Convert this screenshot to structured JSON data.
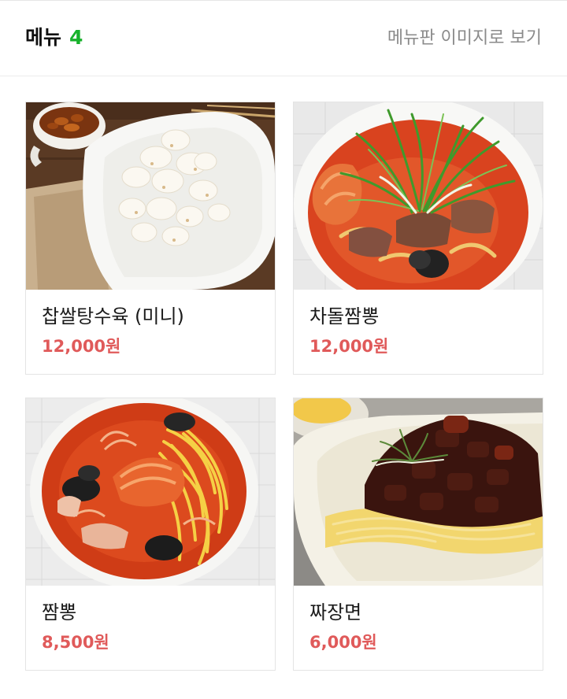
{
  "header": {
    "title": "메뉴",
    "count": "4",
    "board_link": "메뉴판 이미지로 보기"
  },
  "menu_items": [
    {
      "name": "찹쌀탕수육 (미니)",
      "price": "12,000원",
      "image": "sweet-sour-pork-photo"
    },
    {
      "name": "차돌짬뽕",
      "price": "12,000원",
      "image": "brisket-jjamppong-photo"
    },
    {
      "name": "짬뽕",
      "price": "8,500원",
      "image": "jjamppong-photo"
    },
    {
      "name": "짜장면",
      "price": "6,000원",
      "image": "jjajangmyeon-photo"
    }
  ],
  "colors": {
    "count_accent": "#17b22b",
    "price": "#e05a5a"
  }
}
